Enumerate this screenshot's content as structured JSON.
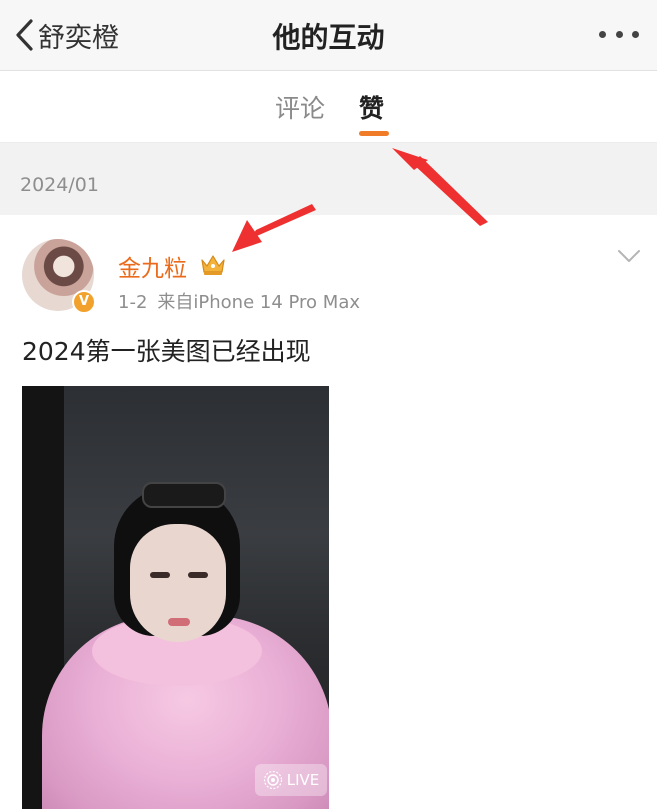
{
  "header": {
    "back_label": "舒奕橙",
    "title": "他的互动"
  },
  "tabs": [
    {
      "label": "评论",
      "active": false
    },
    {
      "label": "赞",
      "active": true
    }
  ],
  "accent_color": "#f07c2a",
  "date_section": "2024/01",
  "post": {
    "author": "金九粒",
    "date": "1-2",
    "source": "来自iPhone 14 Pro Max",
    "text": "2024第一张美图已经出现",
    "verified_badge": "V",
    "live_label": "LIVE",
    "author_color": "#ea6b1b"
  },
  "icons": [
    "back-chevron-icon",
    "more-icon",
    "crown-icon",
    "verified-icon",
    "chevron-down-icon",
    "live-photo-icon"
  ],
  "annotations": [
    {
      "type": "arrow",
      "color": "#ee3030",
      "target": "tab-likes"
    },
    {
      "type": "arrow",
      "color": "#ee3030",
      "target": "author-name"
    }
  ]
}
